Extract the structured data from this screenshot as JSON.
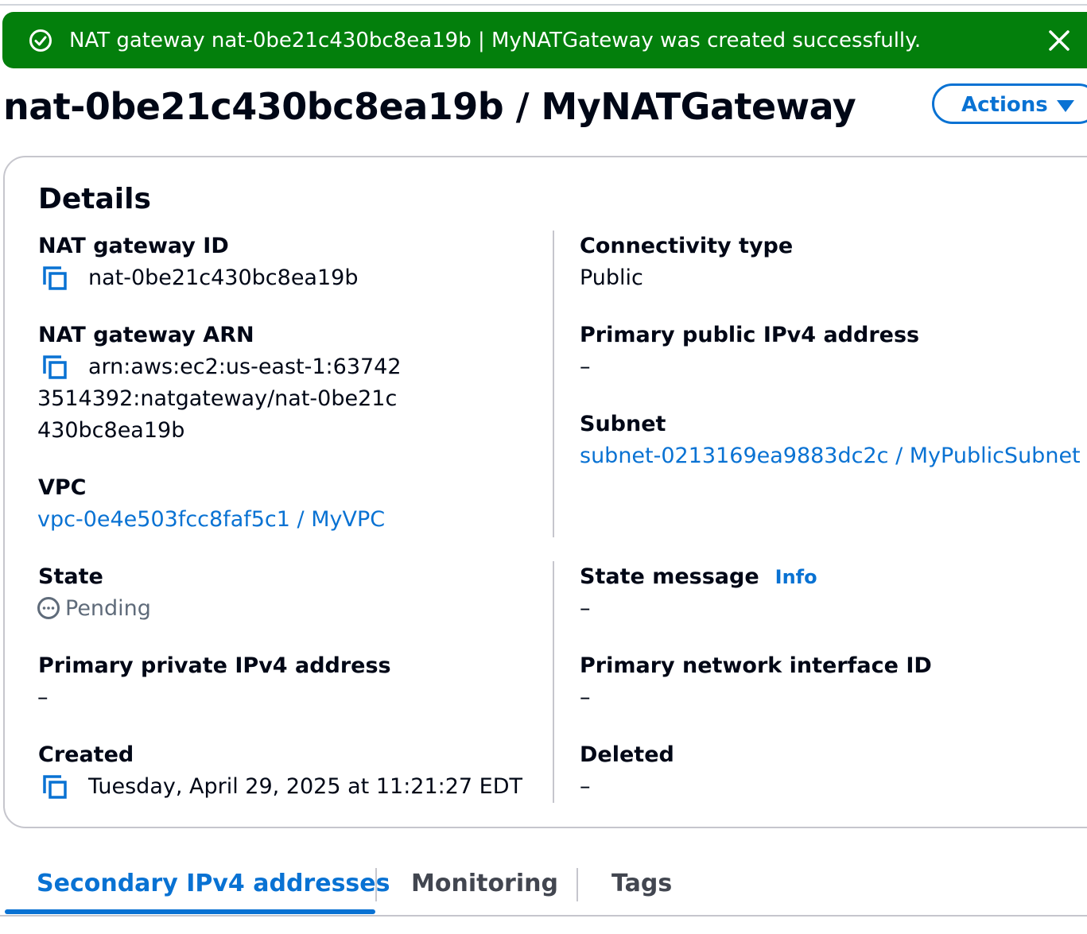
{
  "flash": {
    "message": "NAT gateway nat-0be21c430bc8ea19b | MyNATGateway was created successfully.",
    "color": "#037f0c",
    "icons": {
      "status": "check-circle-icon",
      "dismiss": "close-icon"
    }
  },
  "header": {
    "title": "nat-0be21c430bc8ea19b / MyNATGateway",
    "actions_label": "Actions"
  },
  "details": {
    "heading": "Details",
    "nat_gateway_id": {
      "label": "NAT gateway ID",
      "value": "nat-0be21c430bc8ea19b"
    },
    "nat_gateway_arn": {
      "label": "NAT gateway ARN",
      "value": "arn:aws:ec2:us-east-1:637423514392:natgateway/nat-0be21c430bc8ea19b"
    },
    "vpc": {
      "label": "VPC",
      "value": "vpc-0e4e503fcc8faf5c1 / MyVPC"
    },
    "connectivity_type": {
      "label": "Connectivity type",
      "value": "Public"
    },
    "primary_public_ipv4": {
      "label": "Primary public IPv4 address",
      "value": "–"
    },
    "subnet": {
      "label": "Subnet",
      "value": "subnet-0213169ea9883dc2c / MyPublicSubnet"
    },
    "state": {
      "label": "State",
      "value": "Pending"
    },
    "state_message": {
      "label": "State message",
      "info": "Info",
      "value": "–"
    },
    "primary_private_ipv4": {
      "label": "Primary private IPv4 address",
      "value": "–"
    },
    "primary_network_interface": {
      "label": "Primary network interface ID",
      "value": "–"
    },
    "created": {
      "label": "Created",
      "value": "Tuesday, April 29, 2025 at 11:21:27 EDT"
    },
    "deleted": {
      "label": "Deleted",
      "value": "–"
    }
  },
  "tabs": [
    {
      "label": "Secondary IPv4 addresses",
      "active": true
    },
    {
      "label": "Monitoring",
      "active": false
    },
    {
      "label": "Tags",
      "active": false
    }
  ],
  "colors": {
    "link": "#0972d3",
    "text": "#000716",
    "muted": "#5f6b7a",
    "divider": "#c6c6cd"
  }
}
